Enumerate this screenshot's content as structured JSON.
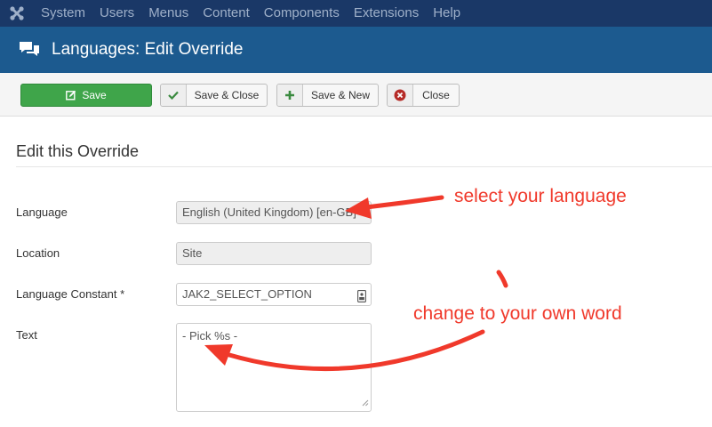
{
  "menubar": {
    "items": [
      "System",
      "Users",
      "Menus",
      "Content",
      "Components",
      "Extensions",
      "Help"
    ]
  },
  "header": {
    "title": "Languages: Edit Override"
  },
  "toolbar": {
    "save_label": "Save",
    "save_close_label": "Save & Close",
    "save_new_label": "Save & New",
    "close_label": "Close"
  },
  "form": {
    "section_title": "Edit this Override",
    "language_label": "Language",
    "language_value": "English (United Kingdom) [en-GB]",
    "location_label": "Location",
    "location_value": "Site",
    "constant_label": "Language Constant *",
    "constant_value": "JAK2_SELECT_OPTION",
    "text_label": "Text",
    "text_value": "- Pick %s -"
  },
  "annotations": {
    "language_note": "select your language",
    "text_note": "change to your own word"
  },
  "colors": {
    "menubar_bg": "#1a3867",
    "header_bg": "#1c5a8f",
    "save_green": "#3fa54a",
    "annotation_red": "#f0392b"
  }
}
